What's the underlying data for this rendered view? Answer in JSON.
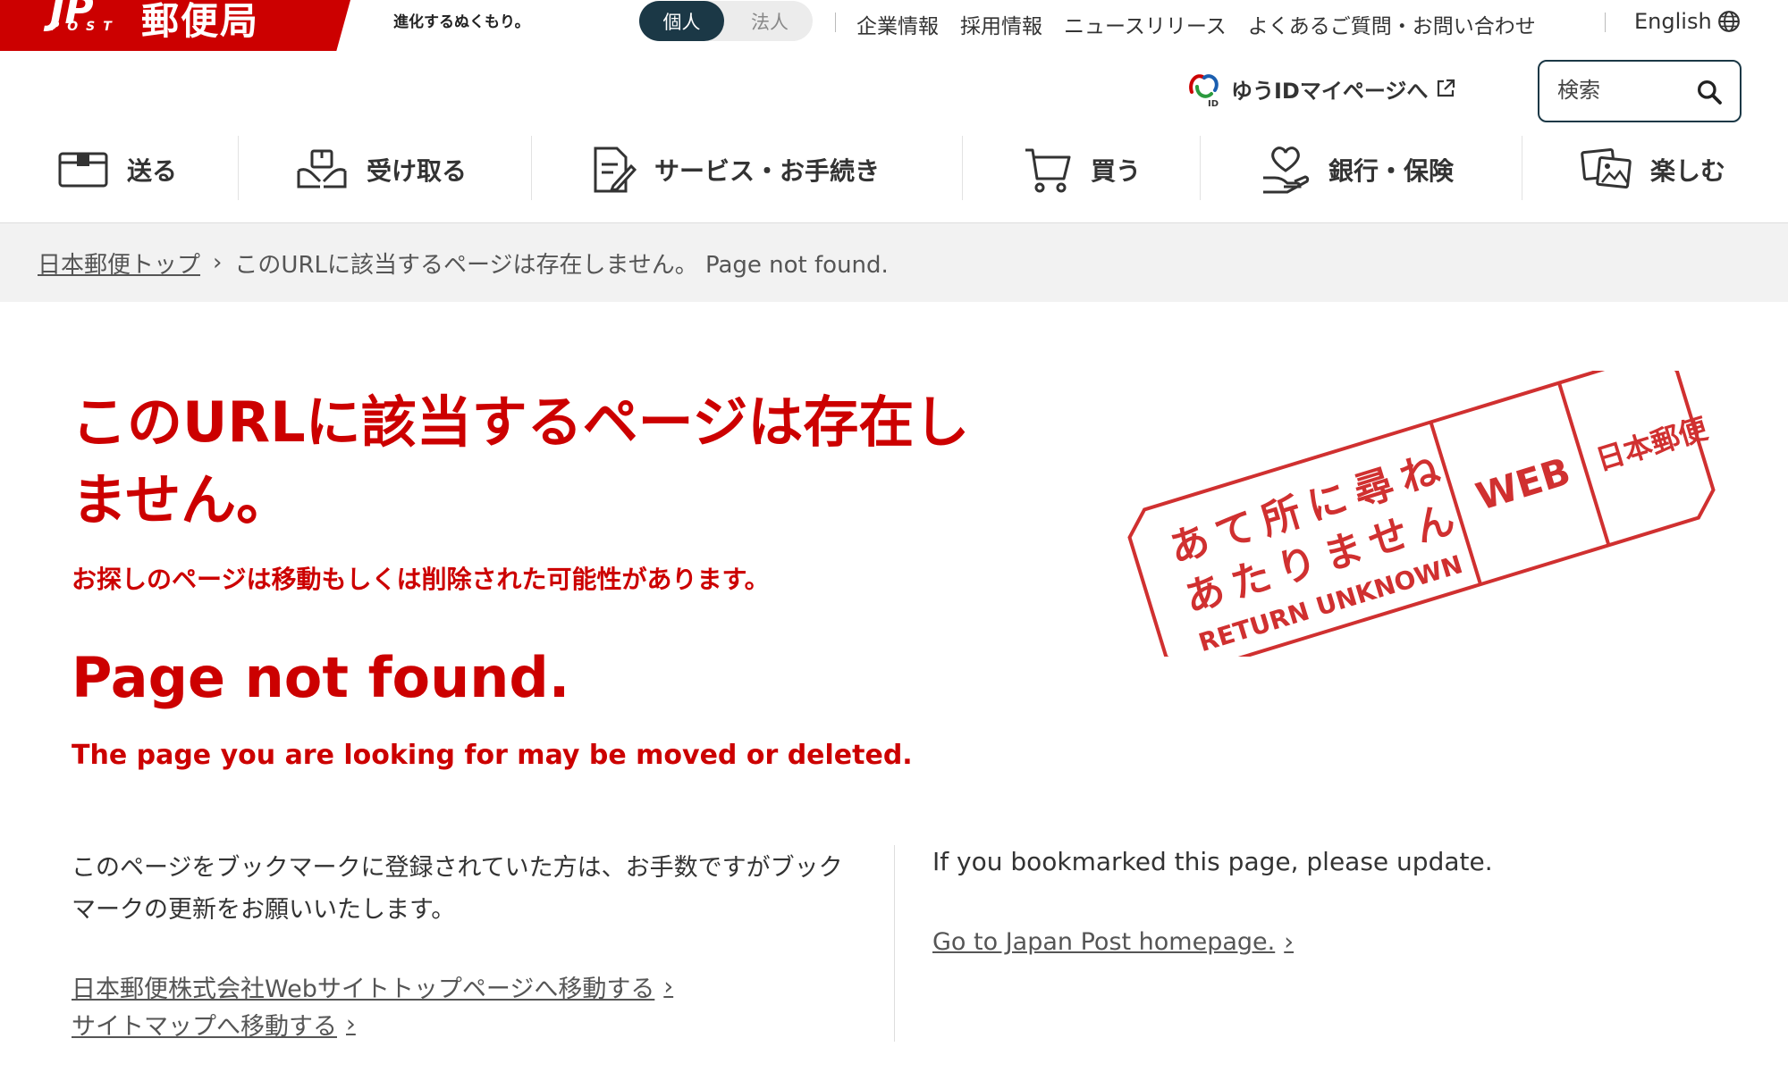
{
  "colors": {
    "brand_red": "#cc0000",
    "dark_navy": "#1b3846",
    "breadcrumb_bg": "#f2f2f2"
  },
  "header": {
    "logo": {
      "mark": "JP",
      "post": "POST",
      "name": "郵便局"
    },
    "tagline": "進化するぬくもり。",
    "segment": {
      "active": "個人",
      "inactive": "法人"
    },
    "top_links": [
      "企業情報",
      "採用情報",
      "ニュースリリース",
      "よくあるご質問・お問い合わせ"
    ],
    "language": "English",
    "yuid_link": "ゆうIDマイページへ",
    "search_placeholder": "検索"
  },
  "nav": [
    {
      "label": "送る",
      "icon": "box-icon"
    },
    {
      "label": "受け取る",
      "icon": "receive-package-icon"
    },
    {
      "label": "サービス・お手続き",
      "icon": "document-pen-icon"
    },
    {
      "label": "買う",
      "icon": "cart-icon"
    },
    {
      "label": "銀行・保険",
      "icon": "heart-hand-icon"
    },
    {
      "label": "楽しむ",
      "icon": "photos-icon"
    }
  ],
  "breadcrumb": {
    "home": "日本郵便トップ",
    "current": "このURLに該当するページは存在しません。 Page not found."
  },
  "content": {
    "title_jp": "このURLに該当するページは存在しません。",
    "subtitle_jp": "お探しのページは移動もしくは削除された可能性があります。",
    "title_en": "Page not found.",
    "subtitle_en": "The page you are looking for may be moved or deleted.",
    "note_jp": "このページをブックマークに登録されていた方は、お手数ですがブックマークの更新をお願いいたします。",
    "link_top_jp": "日本郵便株式会社Webサイトトップページへ移動する",
    "link_sitemap_jp": "サイトマップへ移動する",
    "note_en": "If you bookmarked this page, please update.",
    "link_home_en": "Go to Japan Post homepage."
  },
  "stamp": {
    "line1": "あて所に尋ね",
    "line2": "あたりません",
    "line3": "RETURN UNKNOWN",
    "web": "WEB",
    "org": "日本郵便"
  }
}
